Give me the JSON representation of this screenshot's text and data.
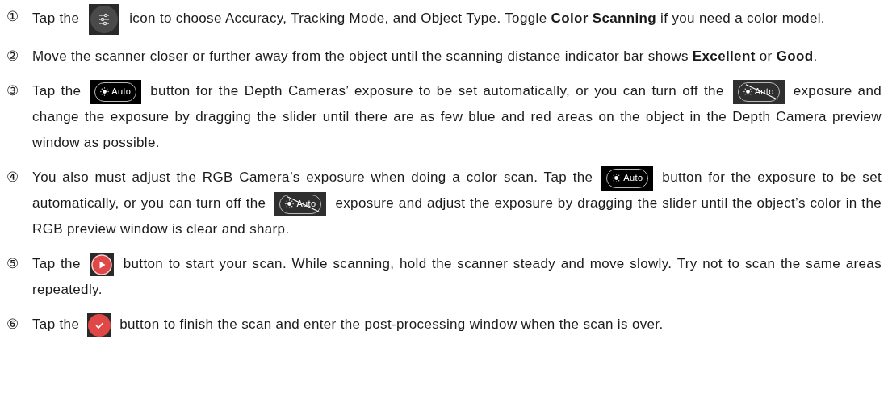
{
  "steps": [
    {
      "number": "①",
      "parts": [
        {
          "kind": "text",
          "text": "Tap the"
        },
        {
          "kind": "settings"
        },
        {
          "kind": "text",
          "text": "icon to choose Accuracy, Tracking Mode, and Object Type. Toggle **Color Scanning** if you need a color model."
        }
      ]
    },
    {
      "number": "②",
      "parts": [
        {
          "kind": "text",
          "text": "Move the scanner closer or further away from the object until the scanning distance indicator bar shows **Excellent** or **Good**."
        }
      ]
    },
    {
      "number": "③",
      "parts": [
        {
          "kind": "text",
          "text": "Tap the"
        },
        {
          "kind": "auto",
          "label": "Auto",
          "on": true
        },
        {
          "kind": "text",
          "text": "button for the Depth Cameras’ exposure to be set automatically, or you can turn off the"
        },
        {
          "kind": "auto",
          "label": "Auto",
          "on": false
        },
        {
          "kind": "text",
          "text": "exposure and change the exposure by dragging the slider until there are as few blue and red areas on the object in the Depth Camera preview window as possible."
        }
      ]
    },
    {
      "number": "④",
      "parts": [
        {
          "kind": "text",
          "text": "You also must adjust the RGB Camera’s exposure when doing a color scan. Tap the"
        },
        {
          "kind": "auto",
          "label": "Auto",
          "on": true
        },
        {
          "kind": "text",
          "text": "button for the exposure to be set automatically, or you can turn off the"
        },
        {
          "kind": "auto",
          "label": "Auto",
          "on": false
        },
        {
          "kind": "text",
          "text": "exposure and adjust the exposure by dragging the slider until the object’s color in the RGB preview window is clear and sharp."
        }
      ]
    },
    {
      "number": "⑤",
      "parts": [
        {
          "kind": "text",
          "text": "Tap the"
        },
        {
          "kind": "record"
        },
        {
          "kind": "text",
          "text": "button to start your scan. While scanning, hold the scanner steady and move slowly. Try not to scan the same areas repeatedly."
        }
      ]
    },
    {
      "number": "⑥",
      "parts": [
        {
          "kind": "text",
          "text": "Tap the"
        },
        {
          "kind": "done"
        },
        {
          "kind": "text",
          "text": "button to finish the scan and enter the post-processing window when the scan is over."
        }
      ]
    }
  ]
}
